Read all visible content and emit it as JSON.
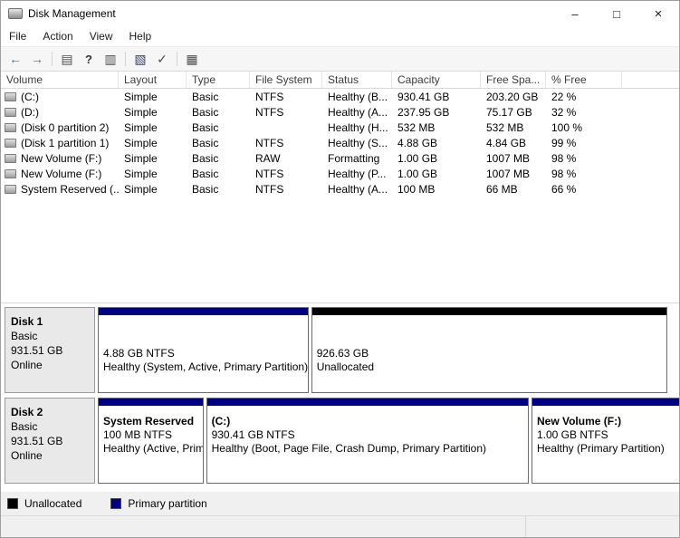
{
  "window": {
    "title": "Disk Management",
    "controls": {
      "minimize": "–",
      "maximize": "□",
      "close": "×"
    }
  },
  "menu": {
    "file": "File",
    "action": "Action",
    "view": "View",
    "help": "Help"
  },
  "toolbar": {
    "buttons": [
      {
        "name": "back",
        "glyph": "←"
      },
      {
        "name": "forward",
        "glyph": "→"
      },
      {
        "name": "console-tree",
        "glyph": "▤"
      },
      {
        "name": "help",
        "glyph": "?"
      },
      {
        "name": "export-list",
        "glyph": "▥"
      },
      {
        "name": "action-pane",
        "glyph": "▧"
      },
      {
        "name": "check",
        "glyph": "✓"
      },
      {
        "name": "properties",
        "glyph": "▦"
      }
    ]
  },
  "volumes": {
    "columns": [
      "Volume",
      "Layout",
      "Type",
      "File System",
      "Status",
      "Capacity",
      "Free Spa...",
      "% Free"
    ],
    "rows": [
      {
        "name": "(C:)",
        "layout": "Simple",
        "type": "Basic",
        "fs": "NTFS",
        "status": "Healthy (B...",
        "capacity": "930.41 GB",
        "free": "203.20 GB",
        "pct": "22 %"
      },
      {
        "name": "(D:)",
        "layout": "Simple",
        "type": "Basic",
        "fs": "NTFS",
        "status": "Healthy (A...",
        "capacity": "237.95 GB",
        "free": "75.17 GB",
        "pct": "32 %"
      },
      {
        "name": "(Disk 0 partition 2)",
        "layout": "Simple",
        "type": "Basic",
        "fs": "",
        "status": "Healthy (H...",
        "capacity": "532 MB",
        "free": "532 MB",
        "pct": "100 %"
      },
      {
        "name": "(Disk 1 partition 1)",
        "layout": "Simple",
        "type": "Basic",
        "fs": "NTFS",
        "status": "Healthy (S...",
        "capacity": "4.88 GB",
        "free": "4.84 GB",
        "pct": "99 %"
      },
      {
        "name": "New Volume (F:)",
        "layout": "Simple",
        "type": "Basic",
        "fs": "RAW",
        "status": "Formatting",
        "capacity": "1.00 GB",
        "free": "1007 MB",
        "pct": "98 %"
      },
      {
        "name": "New Volume (F:)",
        "layout": "Simple",
        "type": "Basic",
        "fs": "NTFS",
        "status": "Healthy (P...",
        "capacity": "1.00 GB",
        "free": "1007 MB",
        "pct": "98 %"
      },
      {
        "name": "System Reserved (...",
        "layout": "Simple",
        "type": "Basic",
        "fs": "NTFS",
        "status": "Healthy (A...",
        "capacity": "100 MB",
        "free": "66 MB",
        "pct": "66 %"
      }
    ]
  },
  "disks": [
    {
      "name": "Disk 1",
      "kind": "Basic",
      "size": "931.51 GB",
      "status": "Online",
      "partitions": [
        {
          "title": "",
          "capacity": "4.88 GB NTFS",
          "status": "Healthy (System, Active, Primary Partition)",
          "color": "#000082"
        },
        {
          "title": "",
          "capacity": "926.63 GB",
          "status": "Unallocated",
          "color": "#000000"
        }
      ]
    },
    {
      "name": "Disk 2",
      "kind": "Basic",
      "size": "931.51 GB",
      "status": "Online",
      "partitions": [
        {
          "title": "System Reserved",
          "capacity": "100 MB NTFS",
          "status": "Healthy (Active, Primary Partition)",
          "color": "#000082"
        },
        {
          "title": "(C:)",
          "capacity": "930.41 GB NTFS",
          "status": "Healthy (Boot, Page File, Crash Dump, Primary Partition)",
          "color": "#000082"
        },
        {
          "title": "New Volume  (F:)",
          "capacity": "1.00 GB NTFS",
          "status": "Healthy (Primary Partition)",
          "color": "#000082"
        }
      ]
    }
  ],
  "legend": {
    "items": [
      {
        "label": "Unallocated",
        "color": "#000000"
      },
      {
        "label": "Primary partition",
        "color": "#000082"
      }
    ]
  }
}
